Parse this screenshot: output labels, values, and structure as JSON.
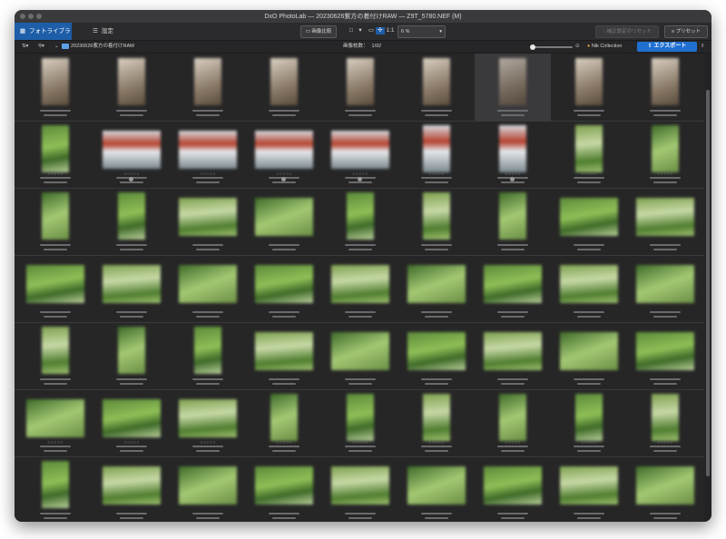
{
  "window": {
    "title": "DxO PhotoLab — 20230626紫方の着付けRAW — Z9T_5780.NEF (M)"
  },
  "toolbar": {
    "tab_library": "フォトライブラリ",
    "tab_customize": "設定",
    "compare_label": "画像比較",
    "zoom_one_to_one": "1:1",
    "zoom_value": "6 %",
    "reset_label": "補正設定のリセット",
    "preset_label": "プリセット"
  },
  "pathbar": {
    "folder_name": "20230626紫方の着付けRAW",
    "image_count_label": "画像枚数：",
    "image_count_value": "1/92",
    "nik_label": "Nik Collection",
    "export_label": "エクスポート"
  },
  "thumbnail": {
    "stars": "○○○○○"
  },
  "icons": {
    "library": "grid-icon",
    "customize": "sliders-icon",
    "compare": "compare-icon",
    "export": "upload-icon",
    "share": "share-icon",
    "folder": "folder-icon",
    "sort": "sort-icon",
    "filter": "filter-icon"
  },
  "colors": {
    "accent": "#1f6fd1",
    "tab_active": "#1e5ea8",
    "background": "#262627",
    "folder": "#5aa2e8"
  }
}
